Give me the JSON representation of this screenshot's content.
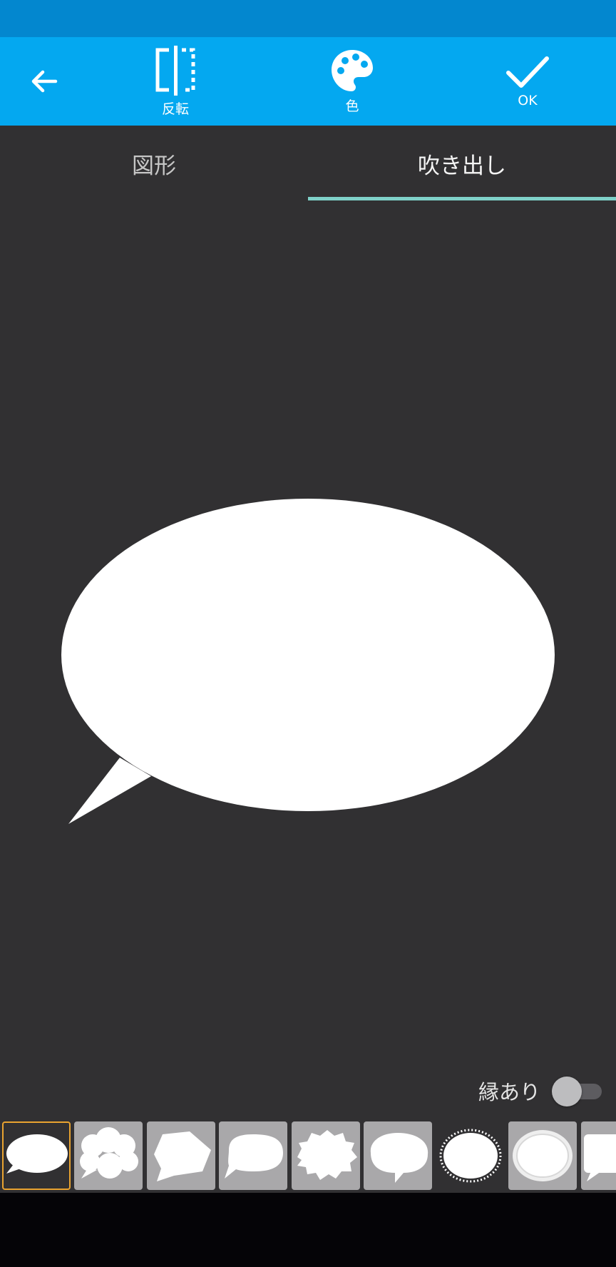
{
  "toolbar": {
    "back_icon": "arrow-left-icon",
    "flip": {
      "icon": "flip-icon",
      "label": "反転"
    },
    "color": {
      "icon": "palette-icon",
      "label": "色"
    },
    "ok": {
      "icon": "check-icon",
      "label": "OK"
    }
  },
  "tabs": [
    {
      "label": "図形",
      "selected": false
    },
    {
      "label": "吹き出し",
      "selected": true
    }
  ],
  "outline": {
    "label": "縁あり",
    "enabled": false
  },
  "balloons": [
    {
      "name": "oval",
      "selected": true
    },
    {
      "name": "cloud",
      "selected": false
    },
    {
      "name": "hexagon",
      "selected": false
    },
    {
      "name": "rounded",
      "selected": false
    },
    {
      "name": "spiky",
      "selected": false
    },
    {
      "name": "wavy",
      "selected": false
    },
    {
      "name": "fuzzy",
      "selected": false
    },
    {
      "name": "glow",
      "selected": false
    },
    {
      "name": "rectangle",
      "selected": false
    }
  ],
  "colors": {
    "status_bar": "#0387cf",
    "toolbar": "#04a8f0",
    "background": "#313032",
    "tab_indicator": "#7fd1c9",
    "selected_border": "#e9a330"
  }
}
